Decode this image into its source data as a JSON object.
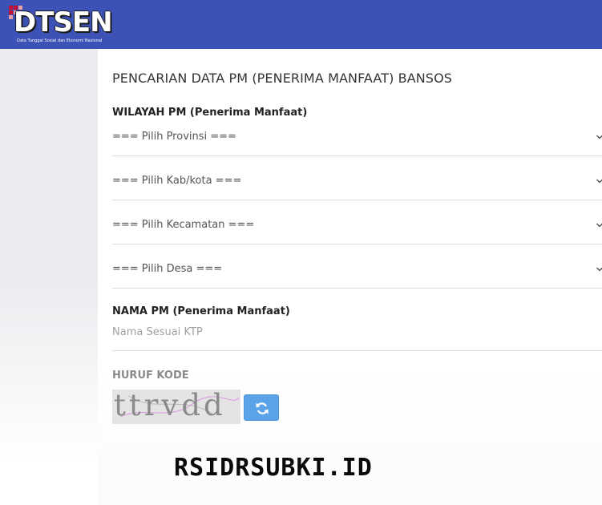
{
  "header": {
    "brand": "DTSEN",
    "tagline": "Data Tunggal Sosial dan Ekonomi Nasional",
    "brand_color": "#3d52b7"
  },
  "form": {
    "title": "PENCARIAN DATA PM (PENERIMA MANFAAT) BANSOS",
    "wilayah_label": "WILAYAH PM (Penerima Manfaat)",
    "provinsi": "=== Pilih Provinsi ===",
    "kabkota": "=== Pilih Kab/kota ===",
    "kecamatan": "=== Pilih Kecamatan ===",
    "desa": "=== Pilih Desa ===",
    "nama_label": "NAMA PM (Penerima Manfaat)",
    "nama_placeholder": "Nama Sesuai KTP",
    "kode_label": "HURUF KODE",
    "captcha_letters": "ttrvdd"
  },
  "icons": {
    "select": "chevron-down-icon",
    "refresh": "refresh-icon"
  },
  "watermark": "RSIDRSUBKI.ID"
}
